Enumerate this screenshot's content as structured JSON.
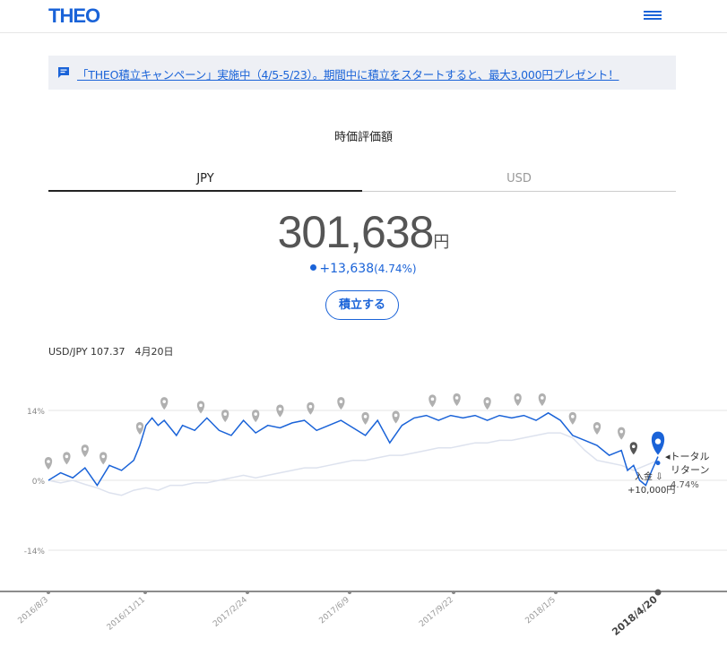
{
  "header": {
    "logo": "THEO",
    "menu_icon": "hamburger-menu-icon"
  },
  "banner": {
    "icon": "chat-bubble-icon",
    "text": "「THEO積立キャンペーン」実施中（4/5-5/23）。期間中に積立をスタートすると、最大3,000円プレゼント！"
  },
  "valuation": {
    "title": "時価評価額",
    "tabs": [
      {
        "label": "JPY",
        "active": true
      },
      {
        "label": "USD",
        "active": false
      }
    ],
    "amount": "301,638",
    "unit": "円",
    "gain": "+13,638",
    "gain_pct": "(4.74%)",
    "button": "積立する",
    "fx_rate": "USD/JPY 107.37　4月20日"
  },
  "colors": {
    "accent": "#1a63d8",
    "benchmark": "#dde2ee",
    "marker": "#b0b0b0"
  },
  "chart_data": {
    "type": "line",
    "x_tick_labels": [
      "2016/8/3",
      "2016/11/11",
      "2017/2/24",
      "2017/6/9",
      "2017/9/22",
      "2018/1/5",
      "2018/4/20"
    ],
    "y_tick_labels": [
      "14%",
      "0%",
      "-14%"
    ],
    "ylim": [
      -14,
      14
    ],
    "annotations": {
      "total_return_label": "◂トータル",
      "total_return_label2": "リターン",
      "total_return_value": "4.74%",
      "deposit_label": "入金",
      "deposit_amount": "+10,000円"
    },
    "series": [
      {
        "key": "portfolio",
        "x": [
          0,
          2,
          4,
          6,
          8,
          10,
          12,
          14,
          15,
          16,
          17,
          18,
          19,
          20,
          21,
          22,
          24,
          26,
          28,
          30,
          32,
          34,
          36,
          38,
          40,
          42,
          44,
          46,
          48,
          50,
          52,
          54,
          56,
          58,
          60,
          62,
          64,
          66,
          68,
          70,
          72,
          74,
          76,
          78,
          80,
          82,
          84,
          86,
          88,
          90,
          92,
          94,
          95,
          96,
          97,
          98,
          99,
          100
        ],
        "values": [
          0,
          1.5,
          0.5,
          2.5,
          -1,
          3,
          2,
          4,
          7,
          11,
          12.5,
          11,
          12,
          10.5,
          9,
          11,
          10,
          12.5,
          10,
          9,
          12,
          9.5,
          11,
          10.5,
          11.5,
          12,
          10,
          11,
          12,
          10.5,
          9,
          12,
          7.5,
          11,
          12.5,
          13,
          12,
          13,
          12.5,
          13,
          12,
          13,
          12.5,
          13,
          12,
          13.5,
          12,
          9,
          8,
          7,
          5,
          6,
          2,
          3,
          0,
          -1,
          2,
          4.74
        ]
      },
      {
        "key": "benchmark",
        "x": [
          0,
          2,
          4,
          6,
          8,
          10,
          12,
          14,
          16,
          18,
          20,
          22,
          24,
          26,
          28,
          30,
          32,
          34,
          36,
          38,
          40,
          42,
          44,
          46,
          48,
          50,
          52,
          54,
          56,
          58,
          60,
          62,
          64,
          66,
          68,
          70,
          72,
          74,
          76,
          78,
          80,
          82,
          84,
          86,
          88,
          90,
          92,
          94,
          96,
          98,
          100
        ],
        "values": [
          0,
          -0.5,
          0,
          -0.8,
          -1.5,
          -2.5,
          -3,
          -2,
          -1.5,
          -2,
          -1,
          -1,
          -0.5,
          -0.5,
          0,
          0.5,
          1,
          0.5,
          1,
          1.5,
          2,
          2.5,
          2.5,
          3,
          3.5,
          4,
          4,
          4.5,
          5,
          5,
          5.5,
          6,
          6.5,
          6.5,
          7,
          7.5,
          7.5,
          8,
          8,
          8.5,
          9,
          9.5,
          9.5,
          8.5,
          6,
          4,
          3.5,
          3,
          2,
          3,
          4
        ]
      }
    ],
    "deposit_markers_x": [
      0,
      3,
      6,
      9,
      15,
      19,
      25,
      29,
      34,
      38,
      43,
      48,
      52,
      57,
      63,
      67,
      72,
      77,
      81,
      86,
      90,
      94,
      96
    ]
  }
}
